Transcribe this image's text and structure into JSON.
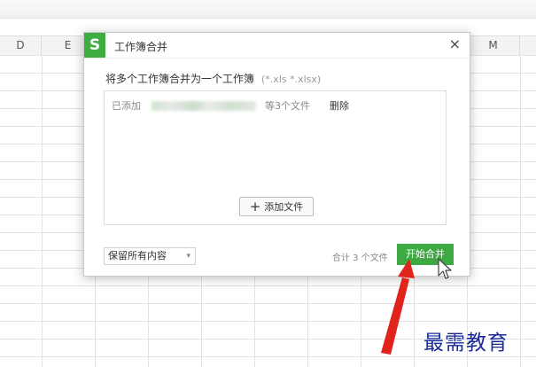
{
  "spreadsheet": {
    "columns": [
      "D",
      "E",
      "",
      "",
      "",
      "",
      "",
      "",
      "",
      "M"
    ]
  },
  "dialog": {
    "logo": "S",
    "title": "工作簿合并",
    "close": "×",
    "instruction": "将多个工作簿合并为一个工作簿",
    "file_hint": "(*.xls *.xlsx)",
    "file_row": {
      "added_label": "已添加",
      "count_text": "等3个文件",
      "delete_label": "删除"
    },
    "add_file_label": "添加文件",
    "keep_option": "保留所有内容",
    "total_text": "合计 3 个文件",
    "merge_button": "开始合并"
  },
  "watermark": "最需教育",
  "colors": {
    "accent_green": "#3ea843",
    "annotation_red": "#e0241b",
    "watermark_blue": "#1a2a9a"
  }
}
